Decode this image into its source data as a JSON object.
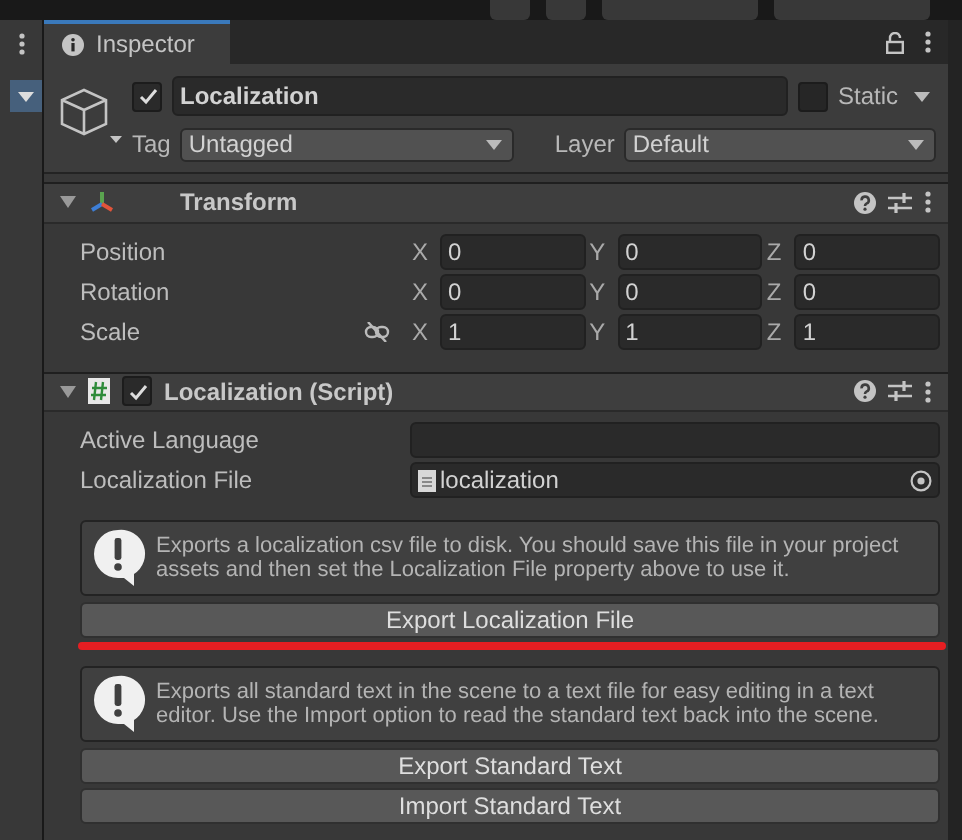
{
  "tab": {
    "title": "Inspector",
    "selected": true
  },
  "object": {
    "active": true,
    "name": "Localization",
    "static": false,
    "static_label": "Static",
    "tag_label": "Tag",
    "tag": "Untagged",
    "layer_label": "Layer",
    "layer": "Default"
  },
  "components": [
    {
      "kind": "transform",
      "title": "Transform",
      "expanded": true,
      "rows": [
        {
          "label": "Position",
          "values": [
            {
              "axis": "X",
              "value": "0"
            },
            {
              "axis": "Y",
              "value": "0"
            },
            {
              "axis": "Z",
              "value": "0"
            }
          ]
        },
        {
          "label": "Rotation",
          "values": [
            {
              "axis": "X",
              "value": "0"
            },
            {
              "axis": "Y",
              "value": "0"
            },
            {
              "axis": "Z",
              "value": "0"
            }
          ]
        },
        {
          "label": "Scale",
          "linked": false,
          "values": [
            {
              "axis": "X",
              "value": "1"
            },
            {
              "axis": "Y",
              "value": "1"
            },
            {
              "axis": "Z",
              "value": "1"
            }
          ]
        }
      ]
    },
    {
      "kind": "script",
      "title": "Localization (Script)",
      "expanded": true,
      "enabled": true,
      "fields": [
        {
          "label": "Active Language",
          "kind": "text"
        },
        {
          "label": "Localization File",
          "kind": "object",
          "value": "localization"
        }
      ],
      "items": [
        {
          "kind": "help",
          "text": "Exports a localization csv file to disk. You should save this file in your project assets and then set the Localization File property above to use it."
        },
        {
          "kind": "button",
          "label": "Export Localization File",
          "underlined": true
        },
        {
          "kind": "help",
          "text": "Exports all standard text in the scene to a text file for easy editing in a text editor. Use the Import option to read the standard text back into the scene."
        },
        {
          "kind": "button",
          "label": "Export Standard Text",
          "underlined": false
        },
        {
          "kind": "button",
          "label": "Import Standard Text",
          "underlined": false
        }
      ]
    }
  ]
}
